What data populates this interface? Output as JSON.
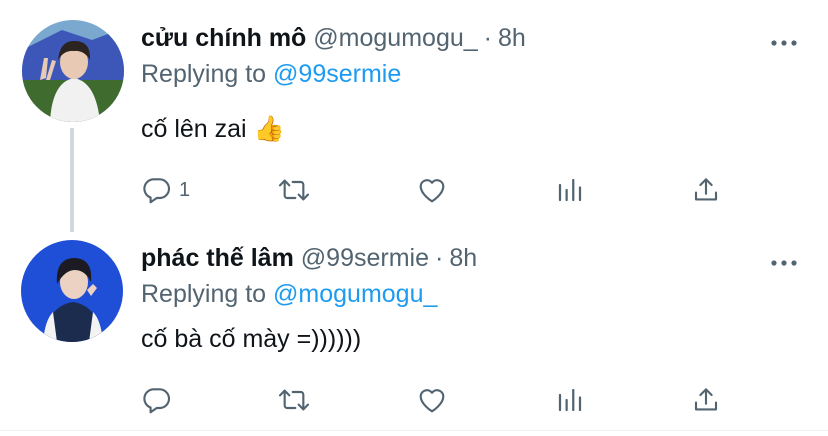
{
  "tweets": [
    {
      "display_name": "cửu chính mô",
      "handle": "@mogumogu_",
      "separator": "·",
      "time": "8h",
      "replying_prefix": "Replying to",
      "replying_to": "@99sermie",
      "text": "cố lên zai 👍",
      "reply_count": "1",
      "avatar_colors": {
        "sky": "#7aa8cf",
        "tent": "#3d57b8",
        "grass": "#3f6b2e",
        "shirt": "#f1f1f1",
        "hair": "#2a2320",
        "skin": "#e8c9b4"
      }
    },
    {
      "display_name": "phác thế lâm",
      "handle": "@99sermie",
      "separator": "·",
      "time": "8h",
      "replying_prefix": "Replying to",
      "replying_to": "@mogumogu_",
      "text": "cố bà cố mày =))))))",
      "reply_count": "",
      "avatar_colors": {
        "bg": "#1f4fd6",
        "jacket": "#1b2c4e",
        "sleeve": "#f3f3f3",
        "hair": "#1c1a22",
        "skin": "#ecd2c3"
      }
    }
  ],
  "icons": {
    "more": "more-horizontal-icon",
    "reply": "reply-icon",
    "retweet": "retweet-icon",
    "like": "heart-icon",
    "stats": "stats-icon",
    "share": "share-icon"
  },
  "colors": {
    "text_primary": "#0f1419",
    "text_secondary": "#536471",
    "link": "#1d9bf0",
    "thread_line": "#cfd9de"
  }
}
